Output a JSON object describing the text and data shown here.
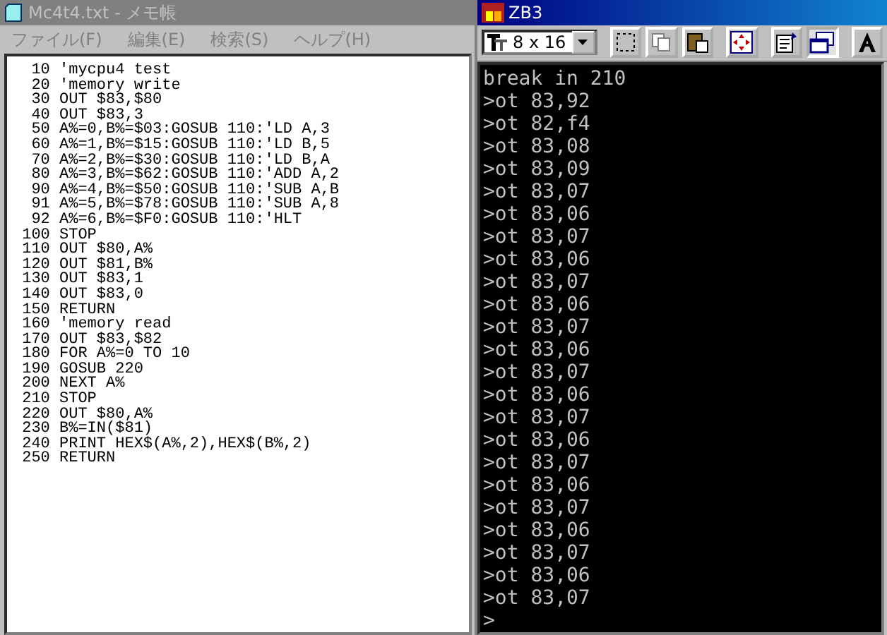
{
  "notepad": {
    "title": "Mc4t4.txt - メモ帳",
    "menu": [
      "ファイル(F)",
      "編集(E)",
      "検索(S)",
      "ヘルプ(H)"
    ],
    "lines": [
      "  10 'mycpu4 test",
      "  20 'memory write",
      "  30 OUT $83,$80",
      "  40 OUT $83,3",
      "  50 A%=0,B%=$03:GOSUB 110:'LD A,3",
      "  60 A%=1,B%=$15:GOSUB 110:'LD B,5",
      "  70 A%=2,B%=$30:GOSUB 110:'LD B,A",
      "  80 A%=3,B%=$62:GOSUB 110:'ADD A,2",
      "  90 A%=4,B%=$50:GOSUB 110:'SUB A,B",
      "  91 A%=5,B%=$78:GOSUB 110:'SUB A,8",
      "  92 A%=6,B%=$F0:GOSUB 110:'HLT",
      " 100 STOP",
      " 110 OUT $80,A%",
      " 120 OUT $81,B%",
      " 130 OUT $83,1",
      " 140 OUT $83,0",
      " 150 RETURN",
      " 160 'memory read",
      " 170 OUT $83,$82",
      " 180 FOR A%=0 TO 10",
      " 190 GOSUB 220",
      " 200 NEXT A%",
      " 210 STOP",
      " 220 OUT $80,A%",
      " 230 B%=IN($81)",
      " 240 PRINT HEX$(A%,2),HEX$(B%,2)",
      " 250 RETURN"
    ]
  },
  "console": {
    "title": "ZB3",
    "font_size": "8 x 16",
    "toolbar": [
      {
        "pressed": false
      },
      {
        "pressed": false
      },
      {
        "pressed": false
      },
      {
        "pressed": false
      },
      {
        "pressed": false
      },
      {
        "pressed": true
      },
      {
        "pressed": false
      }
    ],
    "lines": [
      "break in 210",
      ">ot 83,92",
      ">ot 82,f4",
      ">ot 83,08",
      ">ot 83,09",
      ">ot 83,07",
      ">ot 83,06",
      ">ot 83,07",
      ">ot 83,06",
      ">ot 83,07",
      ">ot 83,06",
      ">ot 83,07",
      ">ot 83,06",
      ">ot 83,07",
      ">ot 83,06",
      ">ot 83,07",
      ">ot 83,06",
      ">ot 83,07",
      ">ot 83,06",
      ">ot 83,07",
      ">ot 83,06",
      ">ot 83,07",
      ">ot 83,06",
      ">ot 83,07",
      ">"
    ]
  }
}
